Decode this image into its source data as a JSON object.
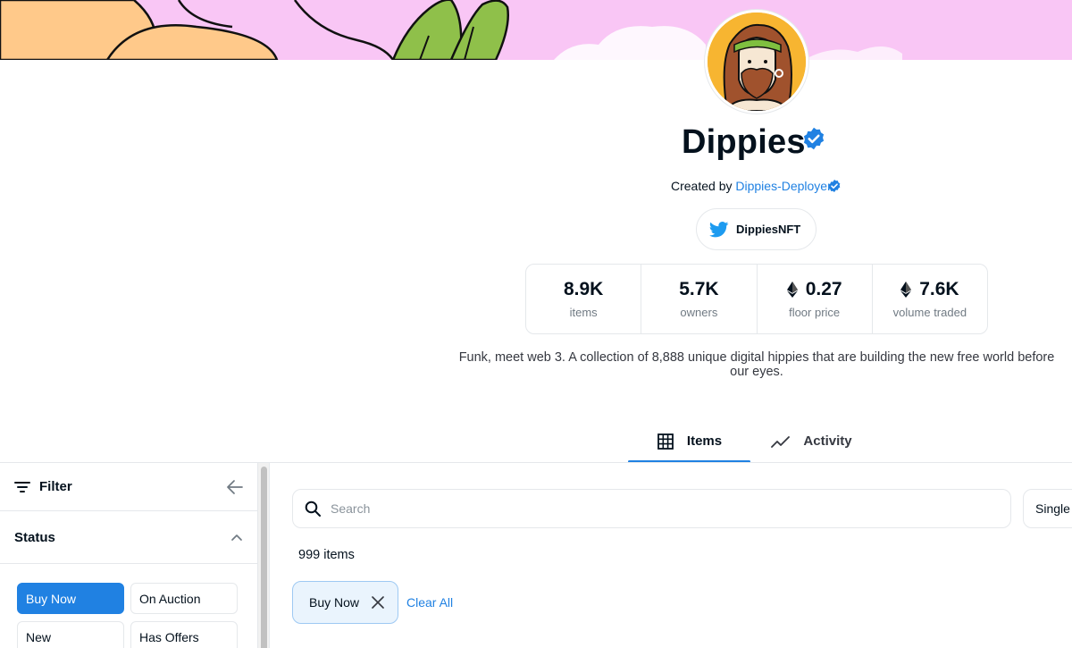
{
  "collection": {
    "name": "Dippies",
    "created_by_prefix": "Created by",
    "creator": "Dippies-Deployer",
    "twitter_handle": "DippiesNFT",
    "description": "Funk, meet web 3. A collection of 8,888 unique digital hippies that are building the new free world before our eyes."
  },
  "stats": [
    {
      "value": "8.9K",
      "label": "items",
      "eth": false
    },
    {
      "value": "5.7K",
      "label": "owners",
      "eth": false
    },
    {
      "value": "0.27",
      "label": "floor price",
      "eth": true
    },
    {
      "value": "7.6K",
      "label": "volume traded",
      "eth": true
    }
  ],
  "tabs": {
    "items": "Items",
    "activity": "Activity"
  },
  "sidebar": {
    "filter_label": "Filter",
    "status_label": "Status",
    "status_options": [
      "Buy Now",
      "On Auction",
      "New",
      "Has Offers"
    ],
    "active_status": "Buy Now"
  },
  "search": {
    "placeholder": "Search"
  },
  "sort_select": "Single",
  "results": {
    "count_text": "999 items"
  },
  "active_filters": {
    "chip_label": "Buy Now",
    "clear_all": "Clear All"
  },
  "colors": {
    "accent": "#2081e2",
    "banner": "#f9c6f5",
    "avatar_bg": "#f7b531"
  },
  "icons": [
    "verified-badge-icon",
    "twitter-icon",
    "ethereum-icon",
    "grid-icon",
    "activity-chart-icon",
    "filter-lines-icon",
    "arrow-left-icon",
    "chevron-up-icon",
    "search-icon",
    "close-icon"
  ]
}
